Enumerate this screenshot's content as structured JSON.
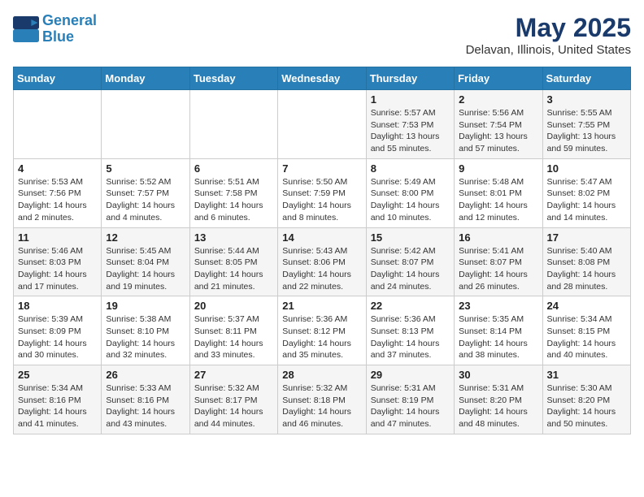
{
  "logo": {
    "line1": "General",
    "line2": "Blue"
  },
  "title": "May 2025",
  "subtitle": "Delavan, Illinois, United States",
  "days_of_week": [
    "Sunday",
    "Monday",
    "Tuesday",
    "Wednesday",
    "Thursday",
    "Friday",
    "Saturday"
  ],
  "weeks": [
    [
      {
        "day": "",
        "info": ""
      },
      {
        "day": "",
        "info": ""
      },
      {
        "day": "",
        "info": ""
      },
      {
        "day": "",
        "info": ""
      },
      {
        "day": "1",
        "info": "Sunrise: 5:57 AM\nSunset: 7:53 PM\nDaylight: 13 hours and 55 minutes."
      },
      {
        "day": "2",
        "info": "Sunrise: 5:56 AM\nSunset: 7:54 PM\nDaylight: 13 hours and 57 minutes."
      },
      {
        "day": "3",
        "info": "Sunrise: 5:55 AM\nSunset: 7:55 PM\nDaylight: 13 hours and 59 minutes."
      }
    ],
    [
      {
        "day": "4",
        "info": "Sunrise: 5:53 AM\nSunset: 7:56 PM\nDaylight: 14 hours and 2 minutes."
      },
      {
        "day": "5",
        "info": "Sunrise: 5:52 AM\nSunset: 7:57 PM\nDaylight: 14 hours and 4 minutes."
      },
      {
        "day": "6",
        "info": "Sunrise: 5:51 AM\nSunset: 7:58 PM\nDaylight: 14 hours and 6 minutes."
      },
      {
        "day": "7",
        "info": "Sunrise: 5:50 AM\nSunset: 7:59 PM\nDaylight: 14 hours and 8 minutes."
      },
      {
        "day": "8",
        "info": "Sunrise: 5:49 AM\nSunset: 8:00 PM\nDaylight: 14 hours and 10 minutes."
      },
      {
        "day": "9",
        "info": "Sunrise: 5:48 AM\nSunset: 8:01 PM\nDaylight: 14 hours and 12 minutes."
      },
      {
        "day": "10",
        "info": "Sunrise: 5:47 AM\nSunset: 8:02 PM\nDaylight: 14 hours and 14 minutes."
      }
    ],
    [
      {
        "day": "11",
        "info": "Sunrise: 5:46 AM\nSunset: 8:03 PM\nDaylight: 14 hours and 17 minutes."
      },
      {
        "day": "12",
        "info": "Sunrise: 5:45 AM\nSunset: 8:04 PM\nDaylight: 14 hours and 19 minutes."
      },
      {
        "day": "13",
        "info": "Sunrise: 5:44 AM\nSunset: 8:05 PM\nDaylight: 14 hours and 21 minutes."
      },
      {
        "day": "14",
        "info": "Sunrise: 5:43 AM\nSunset: 8:06 PM\nDaylight: 14 hours and 22 minutes."
      },
      {
        "day": "15",
        "info": "Sunrise: 5:42 AM\nSunset: 8:07 PM\nDaylight: 14 hours and 24 minutes."
      },
      {
        "day": "16",
        "info": "Sunrise: 5:41 AM\nSunset: 8:07 PM\nDaylight: 14 hours and 26 minutes."
      },
      {
        "day": "17",
        "info": "Sunrise: 5:40 AM\nSunset: 8:08 PM\nDaylight: 14 hours and 28 minutes."
      }
    ],
    [
      {
        "day": "18",
        "info": "Sunrise: 5:39 AM\nSunset: 8:09 PM\nDaylight: 14 hours and 30 minutes."
      },
      {
        "day": "19",
        "info": "Sunrise: 5:38 AM\nSunset: 8:10 PM\nDaylight: 14 hours and 32 minutes."
      },
      {
        "day": "20",
        "info": "Sunrise: 5:37 AM\nSunset: 8:11 PM\nDaylight: 14 hours and 33 minutes."
      },
      {
        "day": "21",
        "info": "Sunrise: 5:36 AM\nSunset: 8:12 PM\nDaylight: 14 hours and 35 minutes."
      },
      {
        "day": "22",
        "info": "Sunrise: 5:36 AM\nSunset: 8:13 PM\nDaylight: 14 hours and 37 minutes."
      },
      {
        "day": "23",
        "info": "Sunrise: 5:35 AM\nSunset: 8:14 PM\nDaylight: 14 hours and 38 minutes."
      },
      {
        "day": "24",
        "info": "Sunrise: 5:34 AM\nSunset: 8:15 PM\nDaylight: 14 hours and 40 minutes."
      }
    ],
    [
      {
        "day": "25",
        "info": "Sunrise: 5:34 AM\nSunset: 8:16 PM\nDaylight: 14 hours and 41 minutes."
      },
      {
        "day": "26",
        "info": "Sunrise: 5:33 AM\nSunset: 8:16 PM\nDaylight: 14 hours and 43 minutes."
      },
      {
        "day": "27",
        "info": "Sunrise: 5:32 AM\nSunset: 8:17 PM\nDaylight: 14 hours and 44 minutes."
      },
      {
        "day": "28",
        "info": "Sunrise: 5:32 AM\nSunset: 8:18 PM\nDaylight: 14 hours and 46 minutes."
      },
      {
        "day": "29",
        "info": "Sunrise: 5:31 AM\nSunset: 8:19 PM\nDaylight: 14 hours and 47 minutes."
      },
      {
        "day": "30",
        "info": "Sunrise: 5:31 AM\nSunset: 8:20 PM\nDaylight: 14 hours and 48 minutes."
      },
      {
        "day": "31",
        "info": "Sunrise: 5:30 AM\nSunset: 8:20 PM\nDaylight: 14 hours and 50 minutes."
      }
    ]
  ]
}
